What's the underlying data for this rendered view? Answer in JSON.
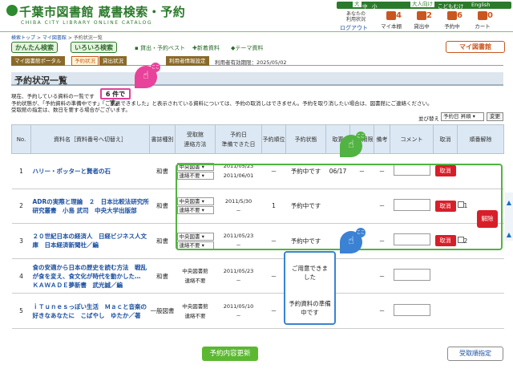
{
  "site": {
    "title": "千葉市図書館 蔵書検索・予約",
    "subtitle": "CHIBA CITY LIBRARY ONLINE CATALOG"
  },
  "topbar": {
    "size_large": "大",
    "size_medium": "中",
    "size_small": "小",
    "adult": "大人向け",
    "kids": "こどもむけ",
    "english": "English"
  },
  "account": {
    "status_line1": "あなたの",
    "status_line2": "利用状況",
    "logout": "ログアウト"
  },
  "header_icons": [
    {
      "label": "マイ本棚",
      "count": "4"
    },
    {
      "label": "貸出中",
      "count": "2"
    },
    {
      "label": "予約中",
      "count": "6"
    },
    {
      "label": "カート",
      "count": "0"
    }
  ],
  "breadcrumb": {
    "home": "検索トップ",
    "mylib": "マイ図書館",
    "current": "予約状況一覧",
    "sep": ">"
  },
  "nav": {
    "easy_search": "かんたん検索",
    "various_search": "いろいろ検索",
    "loan_best": "貸出・予約ベスト",
    "new_books": "新着資料",
    "theme": "テーマ資料",
    "mylib": "マイ図書館"
  },
  "subtabs": [
    "マイ図書館ポータル",
    "予約状況",
    "貸出状況",
    "利用者情報設定"
  ],
  "expiry": "利用者有効期限：2025/05/02",
  "page_title": "予約状況一覧",
  "notes": {
    "count_prefix": "現在、予約している資料の一覧です",
    "count_value": "6 件です。",
    "line2": "予約状態が、「予約資料の準備中です」「ご用意できました」と表示されている資料については、予約の取消しはできません。予約を取り消したい場合は、図書館にご連絡ください。",
    "line3": "受取館の指定は、数日を要する場合がございます。"
  },
  "sort": {
    "label": "並び替え",
    "selected": "予約日 昇順",
    "button": "変更"
  },
  "table": {
    "headers": {
      "no": "No.",
      "title": "資料名［資料番号へ切替え］",
      "type": "書誌種別",
      "pickup_top": "受取館",
      "pickup_bottom": "連絡方法",
      "date_top": "予約日",
      "date_bottom": "準備できた日",
      "order": "予約順位",
      "status": "予約状態",
      "rec": "取置",
      "deadline": "予約期限",
      "remarks": "備考",
      "comment": "コメント",
      "cancel": "取消",
      "release": "順番解除"
    },
    "rows": [
      {
        "no": "1",
        "title": "ハリー・ポッターと賢者の石",
        "type": "和書",
        "pickup": "中央図書",
        "contact": "連絡不要",
        "date": "2011/05/23",
        "ready": "2011/06/01",
        "order": "－",
        "status": "予約中です",
        "rec": "06/17",
        "deadline": "－",
        "remarks": "－",
        "cancel": "取消"
      },
      {
        "no": "2",
        "title": "ADRの実際と理論　２　日本比較法研究所研究叢書　小島 武司　中央大学出版部",
        "type": "和書",
        "pickup": "中央図書",
        "contact": "連絡不要",
        "date": "2011/5/30",
        "ready": "－",
        "order": "1",
        "status": "予約中です",
        "rec": "",
        "deadline": "",
        "remarks": "－",
        "cancel": "取消",
        "group": "1"
      },
      {
        "no": "3",
        "title": "２０世紀日本の経済人　日経ビジネス人文庫　日本経済新聞社／編",
        "type": "和書",
        "pickup": "中央図書",
        "contact": "連絡不要",
        "date": "2011/05/23",
        "ready": "－",
        "order": "－",
        "status": "予約中です",
        "rec": "",
        "deadline": "",
        "remarks": "－",
        "cancel": "取消",
        "group": "2"
      },
      {
        "no": "4",
        "title": "食の安適から日本の歴史を読む方法　戦乱が食を変え、食文化が時代を動かした…　ＫＡＷＡＤＥ夢新書　武光誠／編",
        "type": "和書",
        "pickup": "中央図書館",
        "contact": "連絡不要",
        "date": "2011/05/23",
        "ready": "－",
        "order": "－",
        "status": "ご用意できました",
        "rec": "",
        "deadline": "",
        "remarks": "－",
        "cancel": ""
      },
      {
        "no": "5",
        "title": "ｉＴｕｎｅｓっぽい生活　Ｍａｃと音楽の好きなあなたに　こばやし　ゆたか／著",
        "type": "一般図書",
        "pickup": "中央図書館",
        "contact": "連絡不要",
        "date": "2011/05/10",
        "ready": "－",
        "order": "－",
        "status": "予約資料の準備中です",
        "rec": "",
        "deadline": "",
        "remarks": "－",
        "cancel": ""
      }
    ]
  },
  "release_button": "解除",
  "bubble_text": "ここ",
  "bottom": {
    "update": "予約内容更新",
    "order": "受取順指定"
  },
  "colors": {
    "brand_green": "#2b7a2b",
    "accent_orange": "#c9561e",
    "cancel_red": "#d71f2a",
    "update_green": "#5cb831"
  }
}
